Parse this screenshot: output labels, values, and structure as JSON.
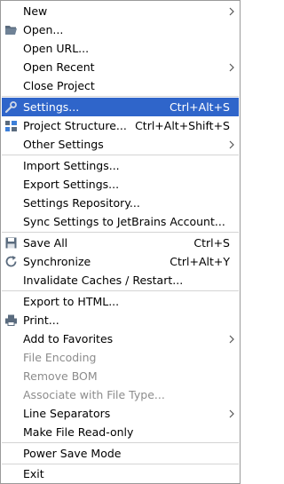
{
  "menu": {
    "new": "New",
    "open_label": "Open...",
    "open_url": "Open URL...",
    "open_recent": "Open Recent",
    "close_project": "Close Project",
    "settings": {
      "label": "Settings...",
      "shortcut": "Ctrl+Alt+S"
    },
    "project_structure": {
      "label": "Project Structure...",
      "shortcut": "Ctrl+Alt+Shift+S"
    },
    "other_settings": "Other Settings",
    "import_settings": "Import Settings...",
    "export_settings": "Export Settings...",
    "settings_repository": "Settings Repository...",
    "sync_settings": "Sync Settings to JetBrains Account...",
    "save_all": {
      "label": "Save All",
      "shortcut": "Ctrl+S"
    },
    "synchronize": {
      "label": "Synchronize",
      "shortcut": "Ctrl+Alt+Y"
    },
    "invalidate_caches": "Invalidate Caches / Restart...",
    "export_html": "Export to HTML...",
    "print": "Print...",
    "add_favorites": "Add to Favorites",
    "file_encoding": "File Encoding",
    "remove_bom": "Remove BOM",
    "associate_file_type": "Associate with File Type...",
    "line_separators": "Line Separators",
    "make_read_only": "Make File Read-only",
    "power_save_mode": "Power Save Mode",
    "exit": "Exit"
  },
  "colors": {
    "selection": "#2f65ca",
    "disabled_text": "#8c8c8c",
    "separator": "#d4d4d4"
  }
}
